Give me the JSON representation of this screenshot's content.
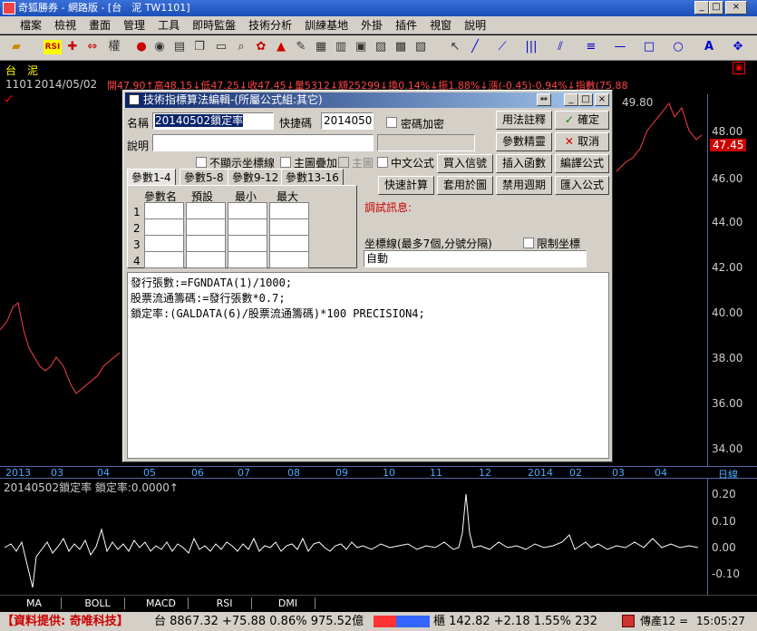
{
  "app": {
    "title": "奇狐勝券 - 網路版 - [台　泥 TW1101]"
  },
  "menu": [
    "檔案",
    "檢視",
    "畫面",
    "管理",
    "工具",
    "即時監盤",
    "技術分析",
    "訓練基地",
    "外掛",
    "插件",
    "視窗",
    "說明"
  ],
  "toolbar": {
    "rsi_label": "RSI",
    "kline_label": "權"
  },
  "quote": {
    "name": "台　泥",
    "code": "1101",
    "date": "2014/05/02",
    "fields": "開47.90↑高48.15↓低47.25↓收47.45↓量5312↓額25299↓換0.14%↓振1.88%↓漲(-0.45)-0.94%↓指數(75.88"
  },
  "chart": {
    "price_labels": [
      "48.00",
      "46.00",
      "44.00",
      "42.00",
      "40.00",
      "38.00",
      "36.00",
      "34.00"
    ],
    "current_price": "47.45",
    "high_label": "49.80",
    "date_labels": [
      "2013",
      "03",
      "04",
      "05",
      "06",
      "07",
      "08",
      "09",
      "10",
      "11",
      "12",
      "2014",
      "02",
      "03",
      "04"
    ],
    "period_label": "日線"
  },
  "indicator": {
    "header": "20140502鎖定率  鎖定率:0.0000↑",
    "axis_labels": [
      "0.20",
      "0.10",
      "0.00",
      "-0.10"
    ]
  },
  "tabs": [
    "MA",
    "BOLL",
    "MACD",
    "RSI",
    "DMI"
  ],
  "status": {
    "provider": "【資料提供: 奇唯科技】",
    "index_text": "台 8867.32 +75.88 0.86% 975.52億",
    "otc_text": "櫃 142.82 +2.18 1.55% 232",
    "pager": "傳產12 =",
    "time": "15:05:27"
  },
  "dialog": {
    "title": "技術指標算法編輯-(所屬公式組:其它)",
    "name_label": "名稱",
    "name_value": "20140502鎖定率",
    "shortcut_label": "快捷碼",
    "shortcut_value": "2014050",
    "password_label": "密碼加密",
    "desc_label": "說明",
    "hide_axis_label": "不顯示坐標線",
    "overlay_label": "主圖疊加",
    "main_label": "主圖",
    "chinese_label": "中文公式",
    "buttons": {
      "usage": "用法註釋",
      "ok": "確定",
      "refine": "參數精靈",
      "cancel": "取消",
      "buy": "買入信號",
      "insert": "插入函數",
      "compile": "編譯公式",
      "quick": "快速計算",
      "apply": "套用於圖",
      "disable": "禁用週期",
      "import": "匯入公式"
    },
    "param_tabs": [
      "參數1-4",
      "參數5-8",
      "參數9-12",
      "參數13-16"
    ],
    "param_headers": [
      "參數名",
      "預設",
      "最小",
      "最大"
    ],
    "param_rows": [
      "1",
      "2",
      "3",
      "4"
    ],
    "debug_label": "調試訊息:",
    "axis_line_label": "坐標線(最多7個,分號分隔)",
    "limit_axis_label": "限制坐標",
    "axis_line_value": "自動",
    "code_lines": [
      "發行張數:=FGNDATA(1)/1000;",
      "股票流通籌碼:=發行張數*0.7;",
      "鎖定率:(GALDATA(6)/股票流通籌碼)*100 PRECISION4;"
    ]
  }
}
